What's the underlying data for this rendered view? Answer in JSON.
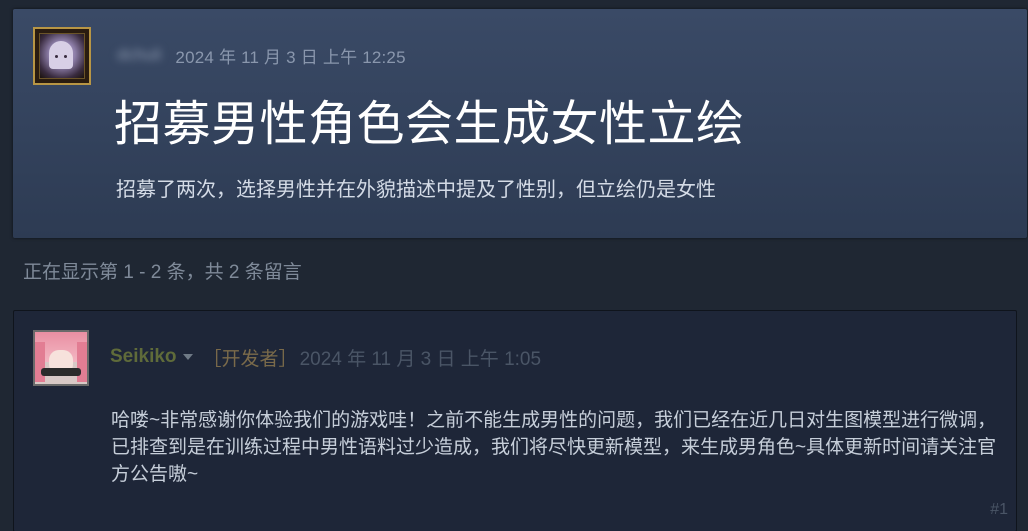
{
  "topic": {
    "author": "dchuli",
    "date": "2024 年 11 月 3 日 上午 12:25",
    "title": "招募男性角色会生成女性立绘",
    "body": "招募了两次，选择男性并在外貌描述中提及了性别，但立绘仍是女性"
  },
  "count_bar": {
    "text": "正在显示第 1 - 2 条，共 2 条留言"
  },
  "comments": [
    {
      "author": "Seikiko",
      "dev_tag": "［开发者］",
      "date": "2024 年 11 月 3 日 上午 1:05",
      "body": "哈喽~非常感谢你体验我们的游戏哇！之前不能生成男性的问题，我们已经在近几日对生图模型进行微调，已排查到是在训练过程中男性语料过少造成，我们将尽快更新模型，来生成男角色~具体更新时间请关注官方公告嗷~",
      "number": "#1"
    }
  ],
  "colors": {
    "topic_bg": "#36455f",
    "page_bg": "#1f2733",
    "comment_bg": "#1e2638",
    "author_dev": "#5f6b3a",
    "title_text": "#ffffff"
  },
  "icons": {
    "topic_avatar": "user-avatar-icon",
    "comment_avatar": "user-avatar-icon",
    "author_menu": "caret-down-icon"
  }
}
